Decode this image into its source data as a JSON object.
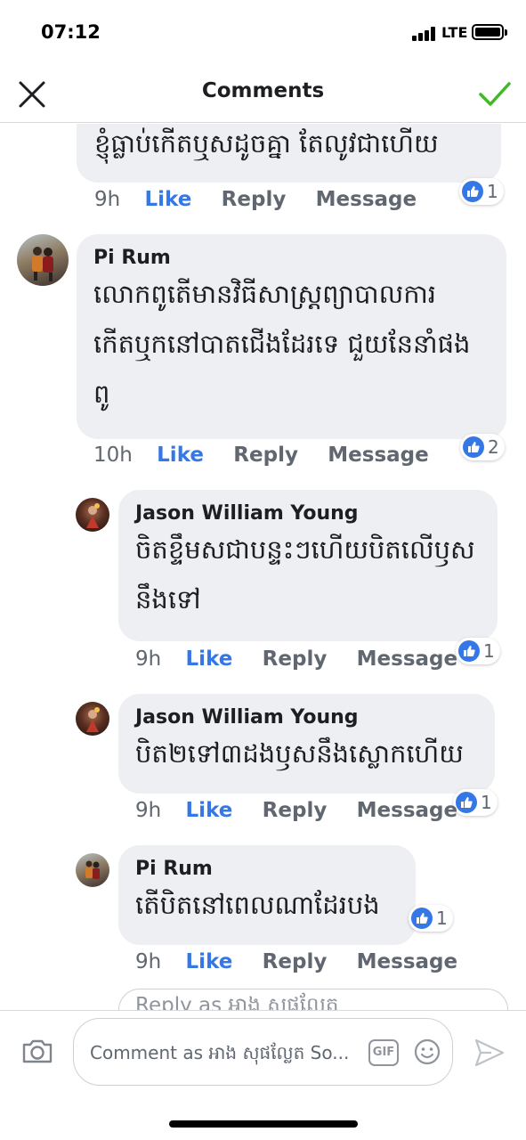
{
  "status_bar": {
    "time": "07:12",
    "network": "LTE"
  },
  "header": {
    "title": "Comments"
  },
  "comments": [
    {
      "author": "",
      "text": "ខ្ញុំធ្លាប់កើតឬសដូចគ្នា តែលូវជាហើយ",
      "time": "9h",
      "like": "Like",
      "reply": "Reply",
      "message": "Message",
      "reactions": "1"
    },
    {
      "author": "Pi Rum",
      "text": "លោកពូតើមានវិធីសាស្រ្តព្យាបាលការ\nកើតឬកនៅបាតជើងដែរទេ ជួយនែនាំផង\nពូ",
      "time": "10h",
      "like": "Like",
      "reply": "Reply",
      "message": "Message",
      "reactions": "2"
    },
    {
      "author": "Jason William Young",
      "text": "ចិតខ្ទឹមសជាបន្ទះៗហើយបិតលើឫស\nនឹងទៅ",
      "time": "9h",
      "like": "Like",
      "reply": "Reply",
      "message": "Message",
      "reactions": "1"
    },
    {
      "author": "Jason William Young",
      "text": "បិត២ទៅ៣ដងឫសនឹងស្លោកហើយ",
      "time": "9h",
      "like": "Like",
      "reply": "Reply",
      "message": "Message",
      "reactions": "1"
    },
    {
      "author": "Pi Rum",
      "text": "តើបិតនៅពេលណាដែរបង",
      "time": "9h",
      "like": "Like",
      "reply": "Reply",
      "message": "Message",
      "reactions": "1"
    }
  ],
  "reply_box": {
    "placeholder": "Reply as អាង សុផល្លែត"
  },
  "composer": {
    "placeholder": "Comment as អាង សុផល្លែត So...",
    "gif_label": "GIF"
  },
  "icons": [
    "close-icon",
    "checkmark-icon",
    "thumbs-up-icon",
    "camera-icon",
    "gif-icon",
    "emoji-icon",
    "send-icon"
  ],
  "colors": {
    "accent": "#3578e5",
    "done": "#42b72a",
    "bubble": "#eeeff2"
  }
}
